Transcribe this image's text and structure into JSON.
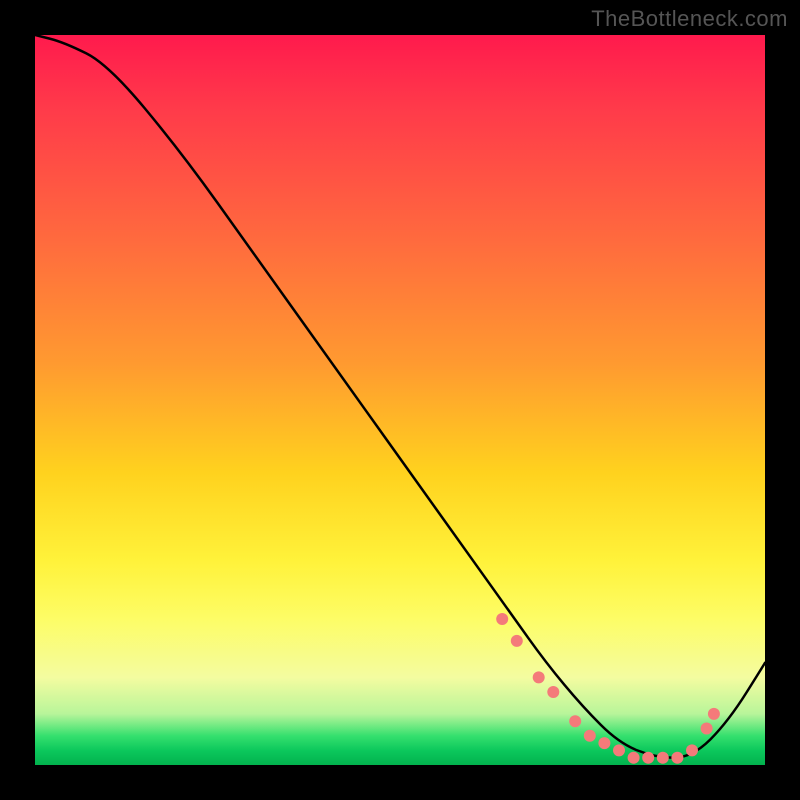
{
  "watermark": "TheBottleneck.com",
  "chart_data": {
    "type": "line",
    "title": "",
    "xlabel": "",
    "ylabel": "",
    "xlim": [
      0,
      100
    ],
    "ylim": [
      0,
      100
    ],
    "series": [
      {
        "name": "curve",
        "x": [
          0,
          4,
          10,
          20,
          30,
          40,
          50,
          60,
          65,
          70,
          75,
          80,
          85,
          90,
          95,
          100
        ],
        "values": [
          100,
          99,
          96,
          84,
          70,
          56,
          42,
          28,
          21,
          14,
          8,
          3,
          1,
          1,
          6,
          14
        ]
      }
    ],
    "markers": {
      "name": "dots",
      "color": "#f47a7a",
      "x": [
        64,
        66,
        69,
        71,
        74,
        76,
        78,
        80,
        82,
        84,
        86,
        88,
        90,
        92,
        93
      ],
      "values": [
        20,
        17,
        12,
        10,
        6,
        4,
        3,
        2,
        1,
        1,
        1,
        1,
        2,
        5,
        7
      ]
    },
    "colors": {
      "curve": "#000000",
      "marker": "#f47a7a",
      "background_top": "#ff1a4d",
      "background_bottom": "#02b24e"
    }
  }
}
